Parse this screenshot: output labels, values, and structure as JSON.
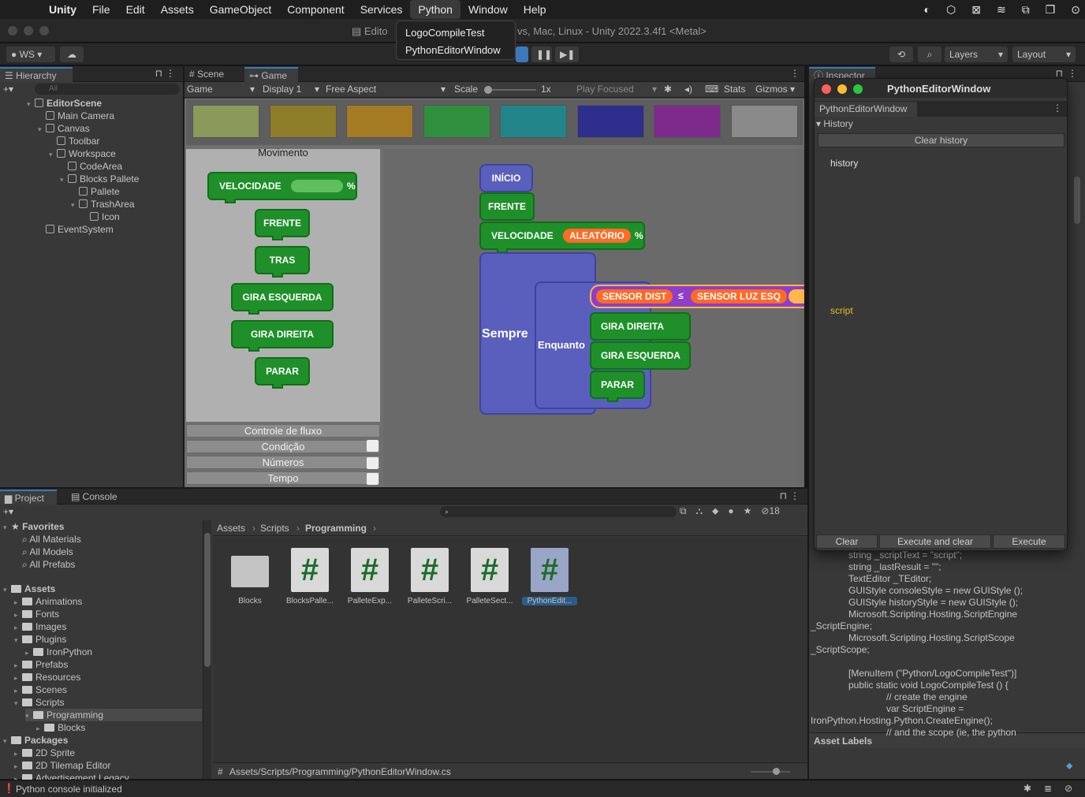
{
  "menubar": {
    "items": [
      "Unity",
      "File",
      "Edit",
      "Assets",
      "GameObject",
      "Component",
      "Services",
      "Python",
      "Window",
      "Help"
    ],
    "active": "Python"
  },
  "python_menu": {
    "items": [
      "LogoCompileTest",
      "PythonEditorWindow"
    ]
  },
  "window": {
    "title_left": "Edito",
    "title_right": "vs, Mac, Linux - Unity 2022.3.4f1 <Metal>"
  },
  "toolbar": {
    "account": "WS",
    "layers": "Layers",
    "layout": "Layout"
  },
  "hierarchy": {
    "tab": "Hierarchy",
    "search": "All",
    "items": [
      {
        "label": "EditorScene",
        "depth": 0,
        "bold": true
      },
      {
        "label": "Main Camera",
        "depth": 1
      },
      {
        "label": "Canvas",
        "depth": 1
      },
      {
        "label": "Toolbar",
        "depth": 2
      },
      {
        "label": "Workspace",
        "depth": 2
      },
      {
        "label": "CodeArea",
        "depth": 3
      },
      {
        "label": "Blocks Pallete",
        "depth": 3
      },
      {
        "label": "Pallete",
        "depth": 4
      },
      {
        "label": "TrashArea",
        "depth": 4
      },
      {
        "label": "Icon",
        "depth": 5
      },
      {
        "label": "EventSystem",
        "depth": 1
      }
    ]
  },
  "gameview": {
    "tabs": [
      "Scene",
      "Game"
    ],
    "bar": {
      "mode": "Game",
      "display": "Display 1",
      "aspect": "Free Aspect",
      "scale_label": "Scale",
      "scale": "1x",
      "play": "Play Focused",
      "stats": "Stats",
      "gizmos": "Gizmos"
    }
  },
  "swatches": [
    "#8b9a5a",
    "#8d7d28",
    "#a47a22",
    "#2f8f3e",
    "#22858a",
    "#2e2e8c",
    "#7d2a8c",
    "#8a8a8a"
  ],
  "palette": {
    "title": "Movimento",
    "velocidade": "VELOCIDADE",
    "percent": "%",
    "blocks": [
      "FRENTE",
      "TRAS",
      "GIRA ESQUERDA",
      "GIRA DIREITA",
      "PARAR"
    ],
    "categories": [
      "Controle de fluxo",
      "Condição",
      "Números",
      "Tempo"
    ]
  },
  "code": {
    "inicio": "INÍCIO",
    "frente": "FRENTE",
    "velocidade": "VELOCIDADE",
    "aleatorio": "ALEATÓRIO",
    "percent": "%",
    "sempre": "Sempre",
    "enquanto": "Enquanto",
    "sensor1": "SENSOR DIST",
    "op": "≤",
    "sensor2": "SENSOR LUZ ESQ",
    "inner": [
      "GIRA DIREITA",
      "GIRA ESQUERDA",
      "PARAR"
    ]
  },
  "inspector": {
    "tab": "Inspector",
    "asset_labels": "Asset Labels"
  },
  "pywin": {
    "title": "PythonEditorWindow",
    "tab": "PythonEditorWindow",
    "history_fold": "History",
    "clear_history": "Clear history",
    "history": "history",
    "script": "script",
    "buttons": [
      "Clear",
      "Execute and clear",
      "Execute"
    ]
  },
  "code_lines": [
    "string _scriptText = \"script\";",
    "string _lastResult = \"\";",
    "TextEditor _TEditor;",
    "GUIStyle consoleStyle = new GUIStyle ();",
    "GUIStyle historyStyle = new GUIStyle ();",
    "Microsoft.Scripting.Hosting.ScriptEngine",
    "_ScriptEngine;",
    "Microsoft.Scripting.Hosting.ScriptScope",
    "_ScriptScope;",
    "",
    "[MenuItem (\"Python/LogoCompileTest\")]",
    "public static void LogoCompileTest () {",
    "// create the engine",
    "var ScriptEngine =",
    "IronPython.Hosting.Python.CreateEngine();",
    "// and the scope (ie, the python"
  ],
  "project": {
    "tabs": [
      "Project",
      "Console"
    ],
    "count": "18",
    "breadcrumb": [
      "Assets",
      "Scripts",
      "Programming"
    ],
    "tree": [
      {
        "label": "Favorites",
        "depth": 0,
        "kind": "star",
        "bold": true
      },
      {
        "label": "All Materials",
        "depth": 1,
        "kind": "search"
      },
      {
        "label": "All Models",
        "depth": 1,
        "kind": "search"
      },
      {
        "label": "All Prefabs",
        "depth": 1,
        "kind": "search"
      },
      {
        "label": "Assets",
        "depth": 0,
        "kind": "folder",
        "bold": true
      },
      {
        "label": "Animations",
        "depth": 1,
        "kind": "folder"
      },
      {
        "label": "Fonts",
        "depth": 1,
        "kind": "folder"
      },
      {
        "label": "Images",
        "depth": 1,
        "kind": "folder"
      },
      {
        "label": "Plugins",
        "depth": 1,
        "kind": "folder"
      },
      {
        "label": "IronPython",
        "depth": 2,
        "kind": "folder"
      },
      {
        "label": "Prefabs",
        "depth": 1,
        "kind": "folder"
      },
      {
        "label": "Resources",
        "depth": 1,
        "kind": "folder"
      },
      {
        "label": "Scenes",
        "depth": 1,
        "kind": "folder"
      },
      {
        "label": "Scripts",
        "depth": 1,
        "kind": "folder"
      },
      {
        "label": "Programming",
        "depth": 2,
        "kind": "folder",
        "selected": true
      },
      {
        "label": "Blocks",
        "depth": 3,
        "kind": "folder"
      },
      {
        "label": "Packages",
        "depth": 0,
        "kind": "folder",
        "bold": true
      },
      {
        "label": "2D Sprite",
        "depth": 1,
        "kind": "folder"
      },
      {
        "label": "2D Tilemap Editor",
        "depth": 1,
        "kind": "folder"
      },
      {
        "label": "Advertisement Legacy",
        "depth": 1,
        "kind": "folder"
      }
    ],
    "assets": [
      "Blocks",
      "BlocksPalle...",
      "PalleteExp...",
      "PalleteScri...",
      "PalleteSect...",
      "PythonEdit..."
    ],
    "path": "Assets/Scripts/Programming/PythonEditorWindow.cs"
  },
  "status": {
    "text": "Python console initialized"
  }
}
